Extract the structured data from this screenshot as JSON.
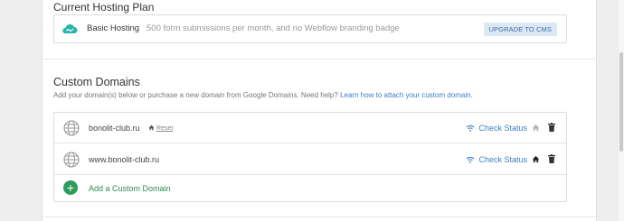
{
  "hosting": {
    "section_title": "Current Hosting Plan",
    "plan_name": "Basic Hosting",
    "plan_description": "500 form submissions per month, and no Webflow branding badge",
    "upgrade_label": "UPGRADE TO CMS"
  },
  "custom_domains": {
    "title": "Custom Domains",
    "help_text": "Add your domain(s) below or purchase a new domain from Google Domains. Need help?",
    "help_link": "Learn how to attach your custom domain.",
    "rows": [
      {
        "domain": "bonolit-club.ru",
        "reset_label": "Reset",
        "check_status_label": "Check Status"
      },
      {
        "domain": "www.bonolit-club.ru",
        "check_status_label": "Check Status"
      }
    ],
    "add_label": "Add a Custom Domain",
    "add_icon_glyph": "+"
  },
  "colors": {
    "link": "#3a7fc4",
    "add_green": "#2e9b5b",
    "upgrade_bg": "#dde8f5"
  }
}
